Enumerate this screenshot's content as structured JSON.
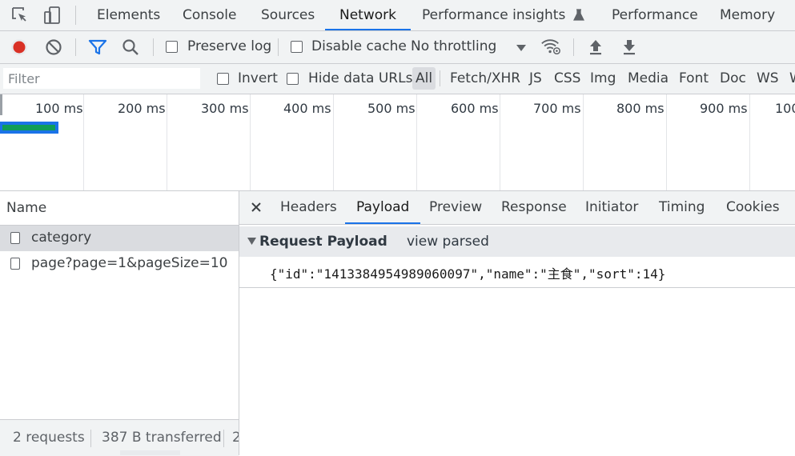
{
  "top_tabs": {
    "items": [
      {
        "label": "Elements"
      },
      {
        "label": "Console"
      },
      {
        "label": "Sources"
      },
      {
        "label": "Network"
      },
      {
        "label": "Performance insights"
      },
      {
        "label": "Performance"
      },
      {
        "label": "Memory"
      }
    ],
    "active": "Network"
  },
  "toolbar": {
    "preserve_log": "Preserve log",
    "disable_cache": "Disable cache",
    "throttling": "No throttling"
  },
  "filter_bar": {
    "placeholder": "Filter",
    "invert": "Invert",
    "hide_data_urls": "Hide data URLs",
    "types": [
      "All",
      "Fetch/XHR",
      "JS",
      "CSS",
      "Img",
      "Media",
      "Font",
      "Doc",
      "WS",
      "W"
    ]
  },
  "overview": {
    "ticks": [
      "100 ms",
      "200 ms",
      "300 ms",
      "400 ms",
      "500 ms",
      "600 ms",
      "700 ms",
      "800 ms",
      "900 ms",
      "100"
    ]
  },
  "requests": {
    "column_name": "Name",
    "items": [
      {
        "name": "category",
        "selected": true
      },
      {
        "name": "page?page=1&pageSize=10",
        "selected": false
      }
    ],
    "status": {
      "count": "2 requests",
      "transferred": "387 B transferred",
      "more": "2"
    }
  },
  "detail": {
    "tabs": [
      "Headers",
      "Payload",
      "Preview",
      "Response",
      "Initiator",
      "Timing",
      "Cookies"
    ],
    "active_tab": "Payload",
    "section_title": "Request Payload",
    "view_toggle": "view parsed",
    "payload": "{\"id\":\"1413384954989060097\",\"name\":\"主食\",\"sort\":14}"
  },
  "colors": {
    "accent": "#1a73e8",
    "record": "#d93025",
    "bar_green": "#0f9d58",
    "bar_blue": "#1a73e8"
  }
}
